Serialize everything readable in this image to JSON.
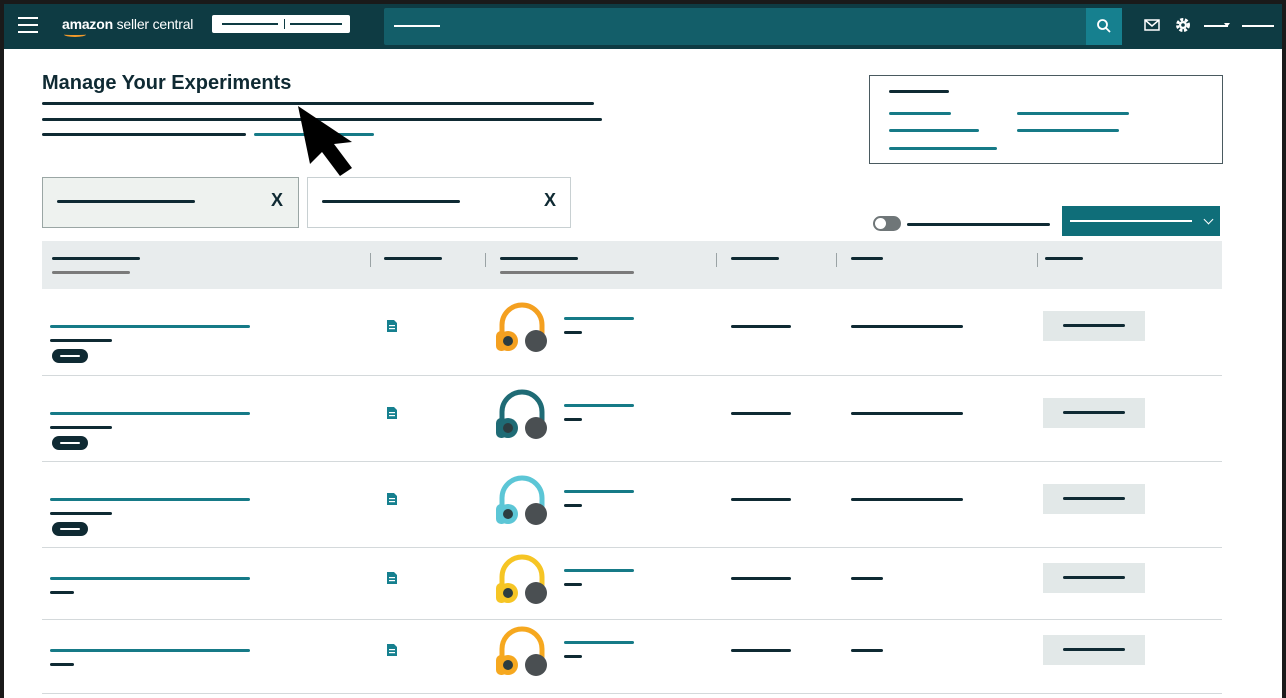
{
  "app": {
    "brand_prefix": "amazon",
    "brand_suffix": " seller central"
  },
  "page": {
    "title": "Manage Your Experiments"
  },
  "filters": [
    {
      "remove_label": "X",
      "selected": true
    },
    {
      "remove_label": "X",
      "selected": false
    }
  ],
  "toggle": {
    "on": false
  },
  "table": {
    "rows": [
      {
        "product_icon": "headphones-orange-icon",
        "accent_color": "#f4a020",
        "has_badge": true
      },
      {
        "product_icon": "headphones-teal-icon",
        "accent_color": "#1f6b75",
        "has_badge": true
      },
      {
        "product_icon": "headphones-lightblue-icon",
        "accent_color": "#5cc6d6",
        "has_badge": true
      },
      {
        "product_icon": "headphones-yellow-icon",
        "accent_color": "#f6c524",
        "has_badge": false
      },
      {
        "product_icon": "headphones-orange-yellow-icon",
        "accent_color": "#f6a81f",
        "has_badge": false
      }
    ]
  },
  "colors": {
    "topbar": "#0e3b43",
    "search": "#135e69",
    "accent": "#16808f",
    "dark_text": "#0f2a33"
  }
}
